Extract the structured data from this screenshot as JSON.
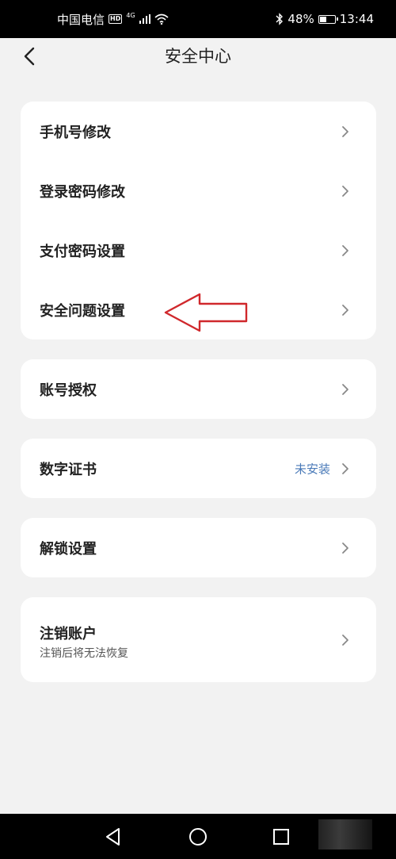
{
  "status_bar": {
    "carrier": "中国电信",
    "hd_badge": "HD",
    "network_type": "4G",
    "battery_percent": "48%",
    "battery_level": 0.48,
    "time": "13:44"
  },
  "header": {
    "title": "安全中心",
    "back_icon": "chevron-left-icon"
  },
  "security_group": {
    "items": [
      {
        "label": "手机号修改"
      },
      {
        "label": "登录密码修改"
      },
      {
        "label": "支付密码设置"
      },
      {
        "label": "安全问题设置"
      }
    ]
  },
  "account_auth": {
    "label": "账号授权"
  },
  "digital_cert": {
    "label": "数字证书",
    "status": "未安装",
    "status_color": "#4a7ab8"
  },
  "unlock_settings": {
    "label": "解锁设置"
  },
  "deregister": {
    "label": "注销账户",
    "subtitle": "注销后将无法恢复"
  },
  "annotation": {
    "color": "#d0282c",
    "icon": "arrow-left-outline-icon"
  },
  "navigation_bar": {
    "icons": [
      "back-triangle-icon",
      "home-circle-icon",
      "recents-square-icon"
    ]
  }
}
